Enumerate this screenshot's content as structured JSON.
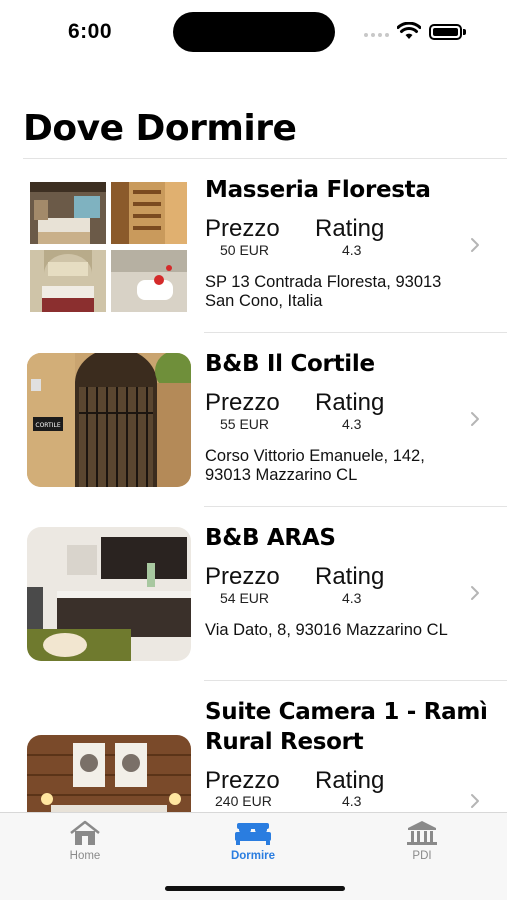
{
  "status_bar": {
    "time": "6:00"
  },
  "page": {
    "title": "Dove Dormire"
  },
  "listings": [
    {
      "name": "Masseria Floresta",
      "price_label": "Prezzo",
      "price": "50 EUR",
      "rating_label": "Rating",
      "rating": "4.3",
      "address": "SP 13 Contrada Floresta, 93013 San Cono, Italia"
    },
    {
      "name": "B&B Il Cortile",
      "price_label": "Prezzo",
      "price": "55 EUR",
      "rating_label": "Rating",
      "rating": "4.3",
      "address": "Corso Vittorio Emanuele, 142, 93013 Mazzarino CL",
      "sign_text": "CORTILE"
    },
    {
      "name": "B&B ARAS",
      "price_label": "Prezzo",
      "price": "54 EUR",
      "rating_label": "Rating",
      "rating": "4.3",
      "address": "Via Dato, 8, 93016 Mazzarino CL"
    },
    {
      "name": "Suite Camera 1 - Ramì Rural Resort",
      "price_label": "Prezzo",
      "price": "240 EUR",
      "rating_label": "Rating",
      "rating": "4.3"
    }
  ],
  "tab_bar": {
    "active_tab": "Dormire",
    "tabs": [
      {
        "label": "Home",
        "icon": "house-icon"
      },
      {
        "label": "Dormire",
        "icon": "bed-icon"
      },
      {
        "label": "PDI",
        "icon": "bank-icon"
      }
    ]
  },
  "colors": {
    "accent": "#2a7de0",
    "inactive": "#8a8a8a",
    "divider": "#e3e3e3"
  }
}
